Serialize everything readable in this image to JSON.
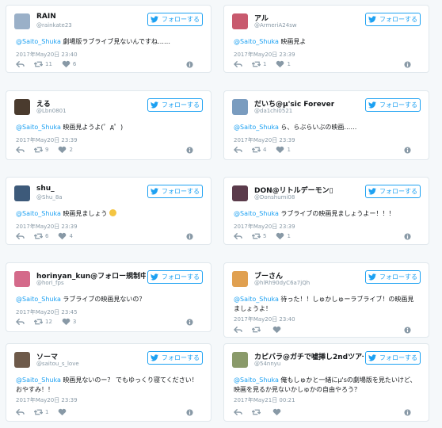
{
  "follow_label": "フォローする",
  "tweets": [
    {
      "name": "RAIN",
      "handle": "@rainkate23",
      "mention": "@Saito_Shuka",
      "text": " 劇場版ラブライブ見ないんですね……",
      "date": "2017年May20日 23:40",
      "retweets": "11",
      "likes": "6",
      "avatar_color": "#9ab0c8"
    },
    {
      "name": "アル",
      "handle": "@ArmeriA24sw",
      "mention": "@Saito_Shuka",
      "text": " 映画見よ",
      "date": "2017年May20日 23:39",
      "retweets": "1",
      "likes": "1",
      "avatar_color": "#c85a6e"
    },
    {
      "name": "える",
      "handle": "@Lbn0801",
      "mention": "@Saito_Shuka",
      "text": " 映画見ようよ(゜д゜)",
      "date": "2017年May20日 23:39",
      "retweets": "9",
      "likes": "2",
      "avatar_color": "#4a3b2e"
    },
    {
      "name": "だいち@μ'sic Forever",
      "handle": "@da1chi0521",
      "mention": "@Saito_Shuka",
      "text": " ら、らぶらいぶの映画……",
      "date": "2017年May20日 23:39",
      "retweets": "4",
      "likes": "1",
      "avatar_color": "#7a9cbf"
    },
    {
      "name": "shu_",
      "handle": "@Shu_8a",
      "mention": "@Saito_Shuka",
      "text": " 映画見ましょう",
      "date": "2017年May20日 23:39",
      "retweets": "6",
      "likes": "4",
      "avatar_color": "#3d5a7a"
    },
    {
      "name": "DON@リトルデーモン▯",
      "handle": "@Donshumi08",
      "mention": "@Saito_Shuka",
      "text": " ラブライブの映画見ましょうよー！！！",
      "date": "2017年May20日 23:39",
      "retweets": "5",
      "likes": "1",
      "avatar_color": "#5b3b4b"
    },
    {
      "name": "horinyan_kun@フォロー規制中",
      "handle": "@hori_fps",
      "mention": "@Saito_Shuka",
      "text": " ラブライブの映画見ないの？",
      "date": "2017年May20日 23:45",
      "retweets": "12",
      "likes": "3",
      "avatar_color": "#d46a8a"
    },
    {
      "name": "ブーさん",
      "handle": "@hlRh90dyC6a7jQh",
      "mention": "@Saito_Shuka",
      "text": " 待った！！しゅかしゅーラブライブ！の映画見ましょうよ！",
      "date": "2017年May20日 23:40",
      "retweets": "",
      "likes": "",
      "avatar_color": "#e0a050"
    },
    {
      "name": "ソーマ",
      "handle": "@saitou_s_love",
      "mention": "@Saito_Shuka",
      "text": " 映画見ないのー？ でもゆっくり寝てください！おやすみ！！",
      "date": "2017年May20日 23:39",
      "retweets": "1",
      "likes": "",
      "avatar_color": "#6e5a4a"
    },
    {
      "name": "カピバラ@ガチで嘘挿し2ndツアー...",
      "handle": "@54nnyu",
      "mention": "@Saito_Shuka",
      "text": " 俺もしゅかと一緒にμ'sの劇場版を見たいけど、映画を見るか見ないかしゅかの自由やろう？",
      "date": "2017年May21日 00:21",
      "retweets": "",
      "likes": "",
      "avatar_color": "#8a9a6a"
    }
  ]
}
